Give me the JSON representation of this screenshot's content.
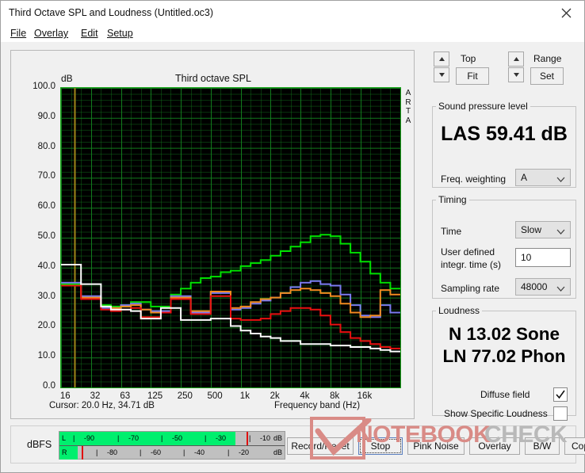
{
  "window": {
    "title": "Third Octave SPL and Loudness (Untitled.oc3)",
    "close_icon": "close-icon"
  },
  "menu": {
    "items": [
      {
        "label": "File"
      },
      {
        "label": "Overlay"
      },
      {
        "label": "Edit"
      },
      {
        "label": "Setup"
      }
    ]
  },
  "chart_panel": {
    "db_label": "dB",
    "arta_watermark": "ARTA",
    "cursor_text": "Cursor:   20.0 Hz, 34.71 dB",
    "freq_band_label": "Frequency band (Hz)"
  },
  "controls": {
    "top": {
      "label": "Top",
      "button": "Fit"
    },
    "range": {
      "label": "Range",
      "button": "Set"
    },
    "spl_group": {
      "legend": "Sound pressure level",
      "value": "LAS 59.41 dB",
      "weighting_label": "Freq. weighting",
      "weighting_value": "A"
    },
    "timing_group": {
      "legend": "Timing",
      "time_label": "Time",
      "time_value": "Slow",
      "integr_label_line1": "User defined",
      "integr_label_line2": "integr. time (s)",
      "integr_value": "10",
      "sampling_label": "Sampling rate",
      "sampling_value": "48000"
    },
    "loudness_group": {
      "legend": "Loudness",
      "sone": "N 13.02 Sone",
      "phon": "LN 77.02 Phon",
      "diffuse_label": "Diffuse field",
      "diffuse_checked": true,
      "specific_label": "Show Specific Loudness",
      "specific_checked": false
    }
  },
  "bottom_bar": {
    "dbfs_label": "dBFS",
    "meter": {
      "left_channel": "L",
      "right_channel": "R",
      "unit": "dB",
      "top_ticks": [
        "-90",
        "-70",
        "-50",
        "-30",
        "-10"
      ],
      "bottom_ticks": [
        "-80",
        "-60",
        "-40",
        "-20"
      ],
      "left_level_pct": 78,
      "left_peak_pct": 83,
      "right_level_pct": 8,
      "right_peak_pct": 10,
      "fill_color": "#00ef6e",
      "peak_color": "#e01010"
    },
    "buttons": [
      {
        "label": "Record/Reset",
        "focused": false
      },
      {
        "label": "Stop",
        "focused": true
      },
      {
        "label": "Pink Noise",
        "focused": false
      },
      {
        "label": "Overlay",
        "focused": false
      },
      {
        "label": "B/W",
        "focused": false
      },
      {
        "label": "Copy",
        "focused": false
      }
    ]
  },
  "watermark": {
    "text_primary": "NOTEBOOK",
    "text_secondary": "CHECK"
  },
  "chart_data": {
    "type": "line",
    "title": "Third octave SPL",
    "xlabel": "Frequency band (Hz)",
    "ylabel": "dB",
    "ylim": [
      0,
      100
    ],
    "ytick_values": [
      100,
      90,
      80,
      70,
      60,
      50,
      40,
      30,
      20,
      10,
      0
    ],
    "ytick_labels": [
      "100.0",
      "90.0",
      "80.0",
      "70.0",
      "60.0",
      "50.0",
      "40.0",
      "30.0",
      "20.0",
      "10.0",
      "0.0"
    ],
    "xtick_labels": [
      "16",
      "32",
      "63",
      "125",
      "250",
      "500",
      "1k",
      "2k",
      "4k",
      "8k",
      "16k"
    ],
    "xtick_values": [
      16,
      32,
      63,
      125,
      250,
      500,
      1000,
      2000,
      4000,
      8000,
      16000
    ],
    "grid": true,
    "grid_color": "#14801f",
    "background": "#000000",
    "cursor_line": {
      "freq": 20.0,
      "value": 34.71,
      "color": "#a08418"
    },
    "x_bands": [
      16,
      20,
      25,
      31.5,
      40,
      50,
      63,
      80,
      100,
      125,
      160,
      200,
      250,
      315,
      400,
      500,
      630,
      800,
      1000,
      1250,
      1600,
      2000,
      2500,
      3150,
      4000,
      5000,
      6300,
      8000,
      10000,
      12500,
      16000,
      20000
    ],
    "series": [
      {
        "name": "green",
        "color": "#00e000",
        "values": [
          34.5,
          34.5,
          30.0,
          30.0,
          27.5,
          27.0,
          27.0,
          28.5,
          28.5,
          27.0,
          27.0,
          31.0,
          33.0,
          35.0,
          36.5,
          37.0,
          38.5,
          39.0,
          40.5,
          41.5,
          42.5,
          44.0,
          45.5,
          47.0,
          48.5,
          50.5,
          51.0,
          50.5,
          48.0,
          45.0,
          42.0,
          38.0,
          35.0,
          33.0
        ]
      },
      {
        "name": "blue",
        "color": "#7b7bf0",
        "values": [
          35.0,
          35.0,
          30.5,
          30.5,
          26.5,
          26.5,
          27.5,
          28.0,
          26.0,
          25.5,
          25.5,
          30.5,
          30.5,
          25.0,
          25.0,
          31.5,
          31.5,
          26.0,
          26.5,
          28.0,
          29.0,
          30.0,
          31.5,
          33.5,
          35.0,
          35.5,
          34.5,
          34.0,
          31.0,
          27.5,
          24.0,
          23.5,
          27.5,
          25.0
        ]
      },
      {
        "name": "orange",
        "color": "#f08a20",
        "values": [
          34.0,
          34.0,
          30.0,
          30.0,
          27.0,
          26.5,
          27.0,
          27.5,
          26.0,
          25.0,
          25.0,
          30.0,
          30.0,
          25.5,
          25.5,
          32.0,
          32.0,
          26.5,
          27.0,
          28.5,
          29.5,
          30.0,
          31.5,
          32.5,
          33.0,
          32.5,
          31.5,
          30.5,
          28.0,
          25.0,
          23.5,
          24.0,
          32.5,
          31.0
        ]
      },
      {
        "name": "red",
        "color": "#e81010",
        "values": [
          34.0,
          34.0,
          29.5,
          29.5,
          26.0,
          25.5,
          26.0,
          26.5,
          23.5,
          23.5,
          25.0,
          29.5,
          29.5,
          24.5,
          24.5,
          30.5,
          30.5,
          23.0,
          22.5,
          22.5,
          23.0,
          24.5,
          25.5,
          26.5,
          26.5,
          26.0,
          24.0,
          21.0,
          18.5,
          16.5,
          15.5,
          14.5,
          13.5,
          13.0
        ]
      },
      {
        "name": "white",
        "color": "#ffffff",
        "values": [
          41.0,
          41.0,
          34.5,
          34.5,
          27.0,
          26.0,
          26.0,
          25.5,
          23.0,
          23.0,
          26.5,
          26.5,
          22.5,
          22.5,
          22.5,
          23.0,
          23.0,
          20.5,
          19.0,
          18.0,
          17.0,
          16.5,
          15.5,
          15.5,
          14.5,
          14.5,
          14.5,
          14.0,
          14.0,
          13.5,
          13.5,
          13.0,
          12.5,
          12.0
        ]
      }
    ]
  }
}
